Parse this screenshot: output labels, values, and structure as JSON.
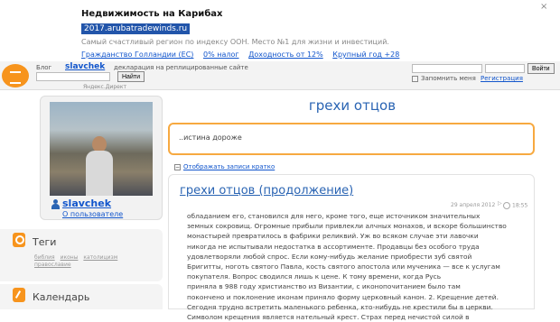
{
  "ad": {
    "title": "Недвижимость на Карибах",
    "url": "2017.arubatradewinds.ru",
    "description": "Самый счастливый регион по индексу ООН. Место №1 для жизни и инвестиций.",
    "links": [
      "Гражданство Голландии (ЕС)",
      "0% налог",
      "Доходность от 12%",
      "Крупный год +28"
    ],
    "close": "×"
  },
  "topbar": {
    "blog_label": "Блог",
    "author": "slavchek",
    "declaration": "декларация на реплицированные сайте",
    "search_button": "Найти",
    "direct_label": "Яндекс.Директ",
    "login_button": "Войти",
    "remember_label": "Запомнить меня",
    "register_link": "Регистрация"
  },
  "profile": {
    "username": "slavchek",
    "about_link": "О пользователе"
  },
  "tags": {
    "title": "Теги",
    "items": [
      "библия",
      "иконы",
      "католицизм",
      "православие"
    ]
  },
  "calendar": {
    "title": "Календарь"
  },
  "blog": {
    "title": "грехи отцов",
    "epigraph": "..истина дороже",
    "collapse_link": "Отображать записи кратко"
  },
  "post": {
    "title": "грехи отцов (продолжение)",
    "date": "29 апреля 2012",
    "time": "18:55",
    "body_lines": [
      "обладанием его, становился для него, кроме того, еще источником значительных",
      "земных сокровищ. Огромные прибыли привлекли алчных монахов, и вскоре большинство",
      "монастырей превратилось в фабрики реликвий. Уж во всяком случае эти лавочки",
      "никогда не испытывали недостатка в ассортименте. Продавцы без особого труда",
      "удовлетворяли любой спрос. Если кому-нибудь желание приобрести зуб святой",
      "Бригитты, ноготь святого Павла, кость святого апостола или мученика — все к услугам",
      "покупателя. Вопрос сводился лишь к цене. К тому времени, когда Русь",
      "приняла в 988 году христианство из Византии, с иконопочитанием было там",
      "покончено и поклонение иконам приняло форму церковный канон. 2. Крещение детей.",
      "Сегодня трудно встретить маленького ребенка, кто-нибудь не крестили бы в церкви.",
      "Символом крещения является нательный крест. Страх перед нечистой силой в"
    ]
  }
}
